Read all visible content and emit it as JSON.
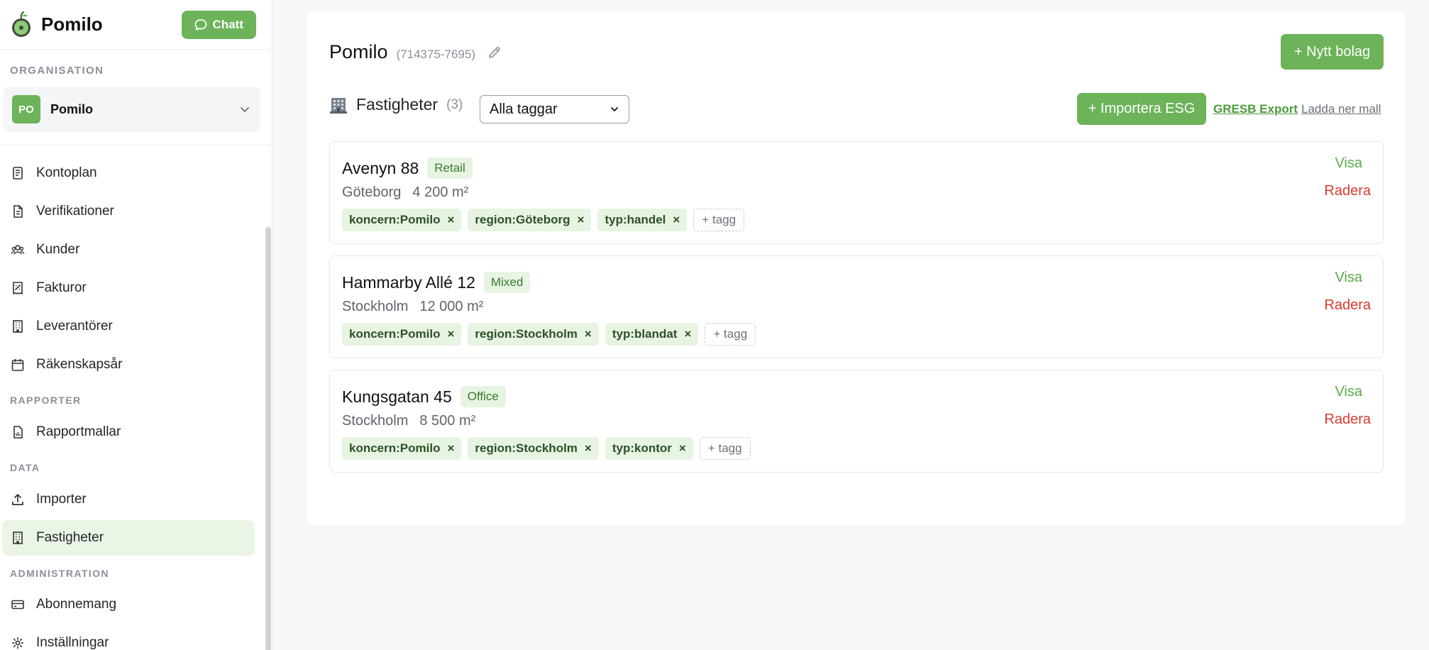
{
  "app": {
    "brand": "Pomilo",
    "chat_label": "Chatt"
  },
  "sidebar": {
    "org_section": "ORGANISATION",
    "org": {
      "initials": "PO",
      "name": "Pomilo"
    },
    "items_main": [
      {
        "label": "Kontoplan",
        "icon": "ledger-icon"
      },
      {
        "label": "Verifikationer",
        "icon": "document-icon"
      },
      {
        "label": "Kunder",
        "icon": "users-icon"
      },
      {
        "label": "Fakturor",
        "icon": "invoice-icon"
      },
      {
        "label": "Leverantörer",
        "icon": "building-icon"
      },
      {
        "label": "Räkenskapsår",
        "icon": "calendar-icon"
      }
    ],
    "section_reports": "RAPPORTER",
    "items_reports": [
      {
        "label": "Rapportmallar",
        "icon": "report-template-icon"
      }
    ],
    "section_data": "DATA",
    "items_data": [
      {
        "label": "Importer",
        "icon": "upload-icon"
      },
      {
        "label": "Fastigheter",
        "icon": "building-icon",
        "active": true
      }
    ],
    "section_admin": "ADMINISTRATION",
    "items_admin": [
      {
        "label": "Abonnemang",
        "icon": "credit-card-icon"
      },
      {
        "label": "Inställningar",
        "icon": "gear-icon"
      }
    ]
  },
  "main": {
    "company_name": "Pomilo",
    "company_id": "(714375-7695)",
    "new_company_label": "+ Nytt bolag",
    "properties_title": "Fastigheter",
    "properties_count": "(3)",
    "tag_filter_value": "Alla taggar",
    "import_esg_label": "+ Importera ESG",
    "gresb_export_label": "GRESB Export",
    "download_template_label": "Ladda ner mall",
    "view_label": "Visa",
    "delete_label": "Radera",
    "add_tag_label": "+ tagg",
    "properties": [
      {
        "name": "Avenyn 88",
        "type": "Retail",
        "city": "Göteborg",
        "area": "4 200 m²",
        "tags": [
          "koncern:Pomilo",
          "region:Göteborg",
          "typ:handel"
        ]
      },
      {
        "name": "Hammarby Allé 12",
        "type": "Mixed",
        "city": "Stockholm",
        "area": "12 000 m²",
        "tags": [
          "koncern:Pomilo",
          "region:Stockholm",
          "typ:blandat"
        ]
      },
      {
        "name": "Kungsgatan 45",
        "type": "Office",
        "city": "Stockholm",
        "area": "8 500 m²",
        "tags": [
          "koncern:Pomilo",
          "region:Stockholm",
          "typ:kontor"
        ]
      }
    ]
  },
  "colors": {
    "accent": "#6cb35a",
    "danger": "#d93a2f",
    "tag_bg": "#e6f4e1",
    "active_nav_bg": "#ebf5e6"
  }
}
